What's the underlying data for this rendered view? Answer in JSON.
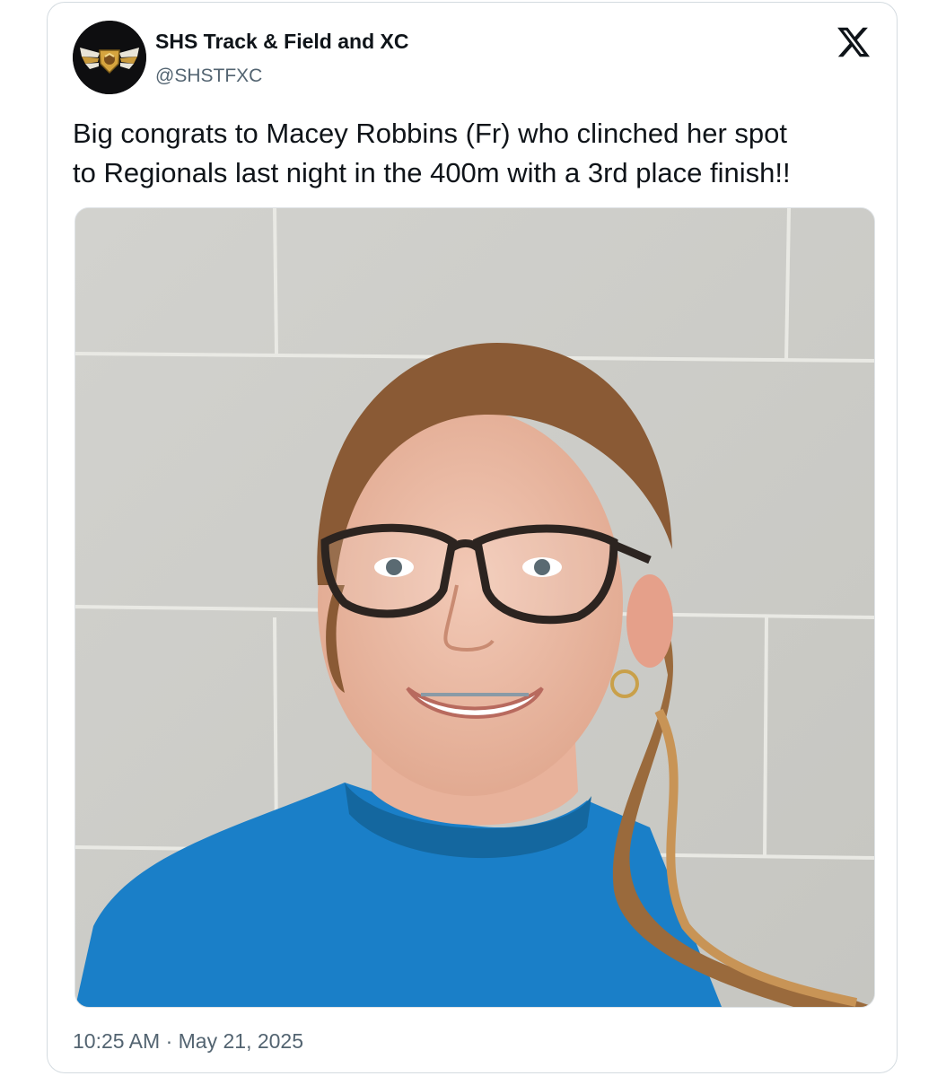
{
  "tweet": {
    "display_name": "SHS Track & Field and XC",
    "handle": "@SHSTFXC",
    "text": "Big congrats to Macey Robbins (Fr) who clinched her spot\nto Regionals last night in the 400m with a 3rd place finish!!",
    "time": "10:25 AM",
    "separator": "·",
    "date": "May 21, 2025",
    "media_alt": "Photo of a smiling girl with glasses and a blue shirt in front of a cinder block wall"
  },
  "icons": {
    "avatar": "winged-mascot-logo",
    "platform": "x-logo-icon"
  },
  "colors": {
    "text_primary": "#0f1419",
    "text_secondary": "#536471",
    "border": "#d4dbe0",
    "wall": "#cfcfcb",
    "shirt": "#1a7fc8",
    "hair": "#8a5a35"
  }
}
